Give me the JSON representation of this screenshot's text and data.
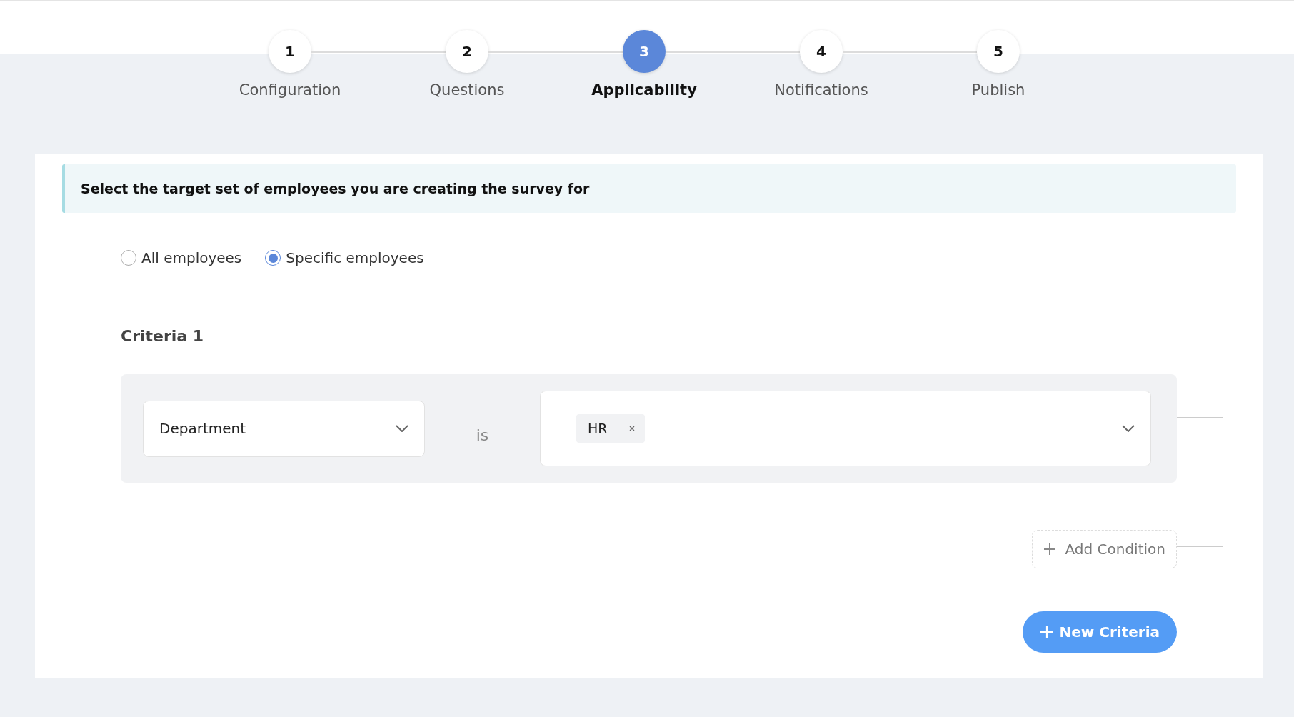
{
  "steps": [
    {
      "number": "1",
      "label": "Configuration",
      "selected": false
    },
    {
      "number": "2",
      "label": "Questions",
      "selected": false
    },
    {
      "number": "3",
      "label": "Applicability",
      "selected": true
    },
    {
      "number": "4",
      "label": "Notifications",
      "selected": false
    },
    {
      "number": "5",
      "label": "Publish",
      "selected": false
    }
  ],
  "banner": {
    "text": "Select the target set of employees you are creating the survey for"
  },
  "audience": [
    {
      "label": "All employees",
      "selected": false
    },
    {
      "label": "Specific employees",
      "selected": true
    }
  ],
  "criteria": [
    {
      "title": "Criteria 1",
      "field": {
        "value": "Department"
      },
      "operator": "is",
      "values": [
        {
          "label": "HR"
        }
      ]
    }
  ],
  "add_condition": {
    "label": "Add Condition"
  },
  "new_criteria": {
    "label": "New Criteria"
  }
}
